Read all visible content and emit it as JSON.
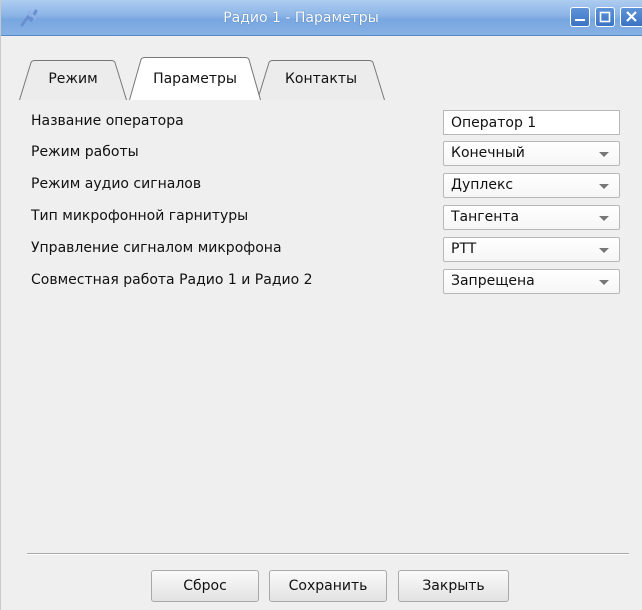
{
  "window": {
    "title": "Радио 1 - Параметры",
    "controls": {
      "minimize_icon": "minimize-icon",
      "maximize_icon": "maximize-icon",
      "close_icon": "close-icon"
    },
    "titlebar_color": "#86b1e5"
  },
  "tabs": [
    {
      "label": "Режим",
      "active": false
    },
    {
      "label": "Параметры",
      "active": true
    },
    {
      "label": "Контакты",
      "active": false
    }
  ],
  "form": {
    "operator_name": {
      "label": "Название оператора",
      "value": "Оператор 1"
    },
    "work_mode": {
      "label": "Режим работы",
      "value": "Конечный"
    },
    "audio_mode": {
      "label": "Режим аудио сигналов",
      "value": "Дуплекс"
    },
    "headset_type": {
      "label": "Тип микрофонной гарнитуры",
      "value": "Тангента"
    },
    "mic_control": {
      "label": "Управление сигналом микрофона",
      "value": "PTT"
    },
    "joint_operation": {
      "label": "Совместная работа Радио 1 и Радио 2",
      "value": "Запрещена"
    }
  },
  "buttons": {
    "reset": "Сброс",
    "save": "Сохранить",
    "close": "Закрыть"
  }
}
